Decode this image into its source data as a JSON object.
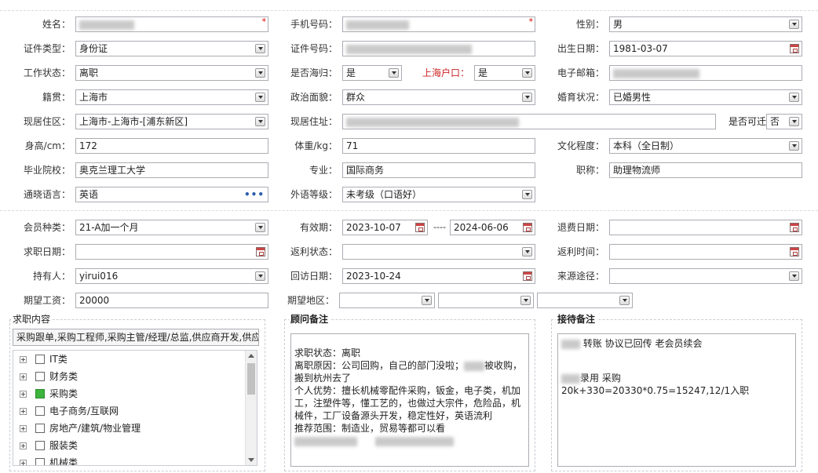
{
  "form": {
    "name": {
      "label": "姓名：",
      "value": "",
      "required": "*"
    },
    "phone": {
      "label": "手机号码：",
      "value": "",
      "required": "*"
    },
    "gender": {
      "label": "性别：",
      "value": "男"
    },
    "id_type": {
      "label": "证件类型：",
      "value": "身份证"
    },
    "id_no": {
      "label": "证件号码：",
      "value": ""
    },
    "birth": {
      "label": "出生日期：",
      "value": "1981-03-07"
    },
    "work_status": {
      "label": "工作状态：",
      "value": "离职"
    },
    "overseas": {
      "label": "是否海归：",
      "value": "是"
    },
    "sh_hukou": {
      "label": "上海户口：",
      "value": "是"
    },
    "email": {
      "label": "电子邮箱：",
      "value": ""
    },
    "native": {
      "label": "籍贯：",
      "value": "上海市"
    },
    "politics": {
      "label": "政治面貌：",
      "value": "群众"
    },
    "marital": {
      "label": "婚育状况：",
      "value": "已婚男性"
    },
    "residence_area": {
      "label": "现居住区：",
      "value": "上海市-上海市-[浦东新区]"
    },
    "address": {
      "label": "现居住址：",
      "value": ""
    },
    "can_transfer": {
      "label": "是否可迁",
      "value": "否"
    },
    "height": {
      "label": "身高/cm：",
      "value": "172"
    },
    "weight": {
      "label": "体重/kg：",
      "value": "71"
    },
    "education": {
      "label": "文化程度：",
      "value": "本科（全日制）"
    },
    "school": {
      "label": "毕业院校：",
      "value": "奥克兰理工大学"
    },
    "major": {
      "label": "专业：",
      "value": "国际商务"
    },
    "title": {
      "label": "职称：",
      "value": "助理物流师"
    },
    "language": {
      "label": "通晓语言：",
      "value": "英语",
      "more": "•••"
    },
    "lang_level": {
      "label": "外语等级：",
      "value": "未考级（口语好）"
    }
  },
  "member": {
    "type": {
      "label": "会员种类：",
      "value": "21-A加一个月"
    },
    "valid": {
      "label": "有效期：",
      "from": "2023-10-07",
      "sep": "----",
      "to": "2024-06-06"
    },
    "refund_date": {
      "label": "退费日期：",
      "value": ""
    },
    "job_date": {
      "label": "求职日期：",
      "value": ""
    },
    "rebate_status": {
      "label": "返利状态：",
      "value": ""
    },
    "rebate_time": {
      "label": "返利时间：",
      "value": ""
    },
    "holder": {
      "label": "持有人：",
      "value": "yirui016"
    },
    "visit_date": {
      "label": "回访日期：",
      "value": "2023-10-24"
    },
    "source": {
      "label": "来源途径：",
      "value": ""
    },
    "salary": {
      "label": "期望工资：",
      "value": "20000"
    },
    "region": {
      "label": "期望地区：",
      "values": [
        "",
        "",
        ""
      ]
    }
  },
  "job_content": {
    "title": "求职内容",
    "summary": "采购跟单,采购工程师,采购主管/经理/总监,供应商开发,供应",
    "tree": [
      {
        "label": "IT类",
        "checked": false
      },
      {
        "label": "财务类",
        "checked": false
      },
      {
        "label": "采购类",
        "checked": true
      },
      {
        "label": "电子商务/互联网",
        "checked": false
      },
      {
        "label": "房地产/建筑/物业管理",
        "checked": false
      },
      {
        "label": "服装类",
        "checked": false
      },
      {
        "label": "机械类",
        "checked": false
      }
    ]
  },
  "advisor": {
    "title": "顾问备注",
    "lines": [
      "求职状态：离职",
      "离职原因：公司回购，自己的部门没啦；",
      "被收购，",
      "搬到杭州去了",
      "个人优势：擅长机械零配件采购，钣金，电子类，机加",
      "工，注塑件等，懂工艺的，也做过大宗件，危险品，机",
      "械件，工厂设备源头开发，稳定性好，英语流利",
      "推荐范围：制造业，贸易等都可以看"
    ]
  },
  "reception": {
    "title": "接待备注",
    "line1": "转账 协议已回传   老会员续会",
    "line2": "录用 采购 20k+330=20330*0.75=15247,12/1入职"
  },
  "colors": {
    "accent_red": "#cc2222",
    "border": "#abadb3",
    "checked": "#3db43d"
  }
}
